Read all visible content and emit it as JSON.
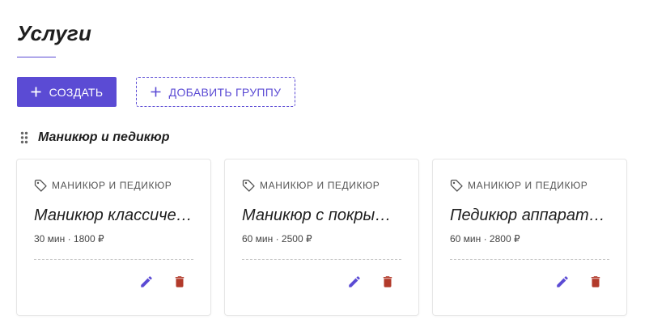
{
  "page": {
    "title": "Услуги"
  },
  "toolbar": {
    "create_label": "Создать",
    "add_group_label": "Добавить группу"
  },
  "group": {
    "title": "Маникюр и педикюр",
    "services": [
      {
        "category": "Маникюр и педикюр",
        "name": "Маникюр классический",
        "duration": "30 мин",
        "price": "1800 ₽",
        "meta": "30 мин · 1800 ₽"
      },
      {
        "category": "Маникюр и педикюр",
        "name": "Маникюр с покрытием",
        "duration": "60 мин",
        "price": "2500 ₽",
        "meta": "60 мин · 2500 ₽"
      },
      {
        "category": "Маникюр и педикюр",
        "name": "Педикюр аппаратный",
        "duration": "60 мин",
        "price": "2800 ₽",
        "meta": "60 мин · 2800 ₽"
      }
    ]
  },
  "icons": {
    "plus": "plus-icon",
    "drag": "drag-handle-icon",
    "tag": "tag-icon",
    "edit": "pencil-icon",
    "delete": "trash-icon"
  },
  "colors": {
    "accent": "#5b4bd4",
    "delete": "#b23a2a"
  }
}
